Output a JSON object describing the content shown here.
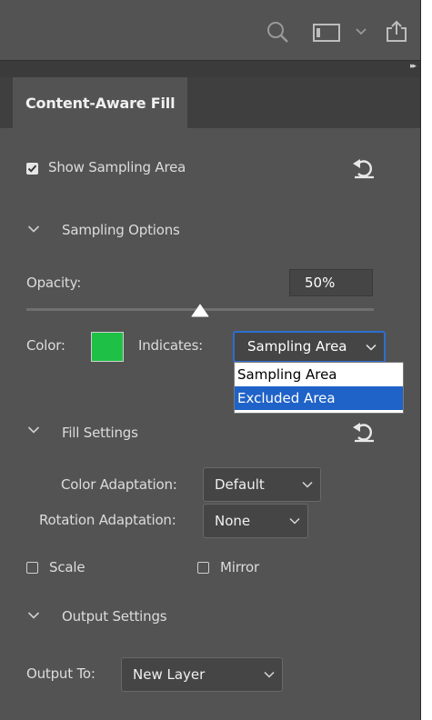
{
  "toolbar": {
    "icons": [
      "search-icon",
      "panel-layout-icon",
      "chevron-down-icon",
      "share-icon"
    ],
    "collapse_glyph": "▸▸"
  },
  "tab": {
    "label": "Content-Aware Fill"
  },
  "show_sampling": {
    "label": "Show Sampling Area",
    "checked": true
  },
  "sampling_options": {
    "title": "Sampling Options",
    "opacity_label": "Opacity:",
    "opacity_value": "50%",
    "opacity_level": 0.5,
    "color_label": "Color:",
    "color": "#1ec145",
    "indicates_label": "Indicates:",
    "indicates_value": "Sampling Area",
    "indicates_options": [
      "Sampling Area",
      "Excluded Area"
    ],
    "highlighted_option": "Excluded Area"
  },
  "fill_settings": {
    "title": "Fill Settings",
    "color_adaptation_label": "Color Adaptation:",
    "color_adaptation_value": "Default",
    "rotation_adaptation_label": "Rotation Adaptation:",
    "rotation_adaptation_value": "None",
    "scale_label": "Scale",
    "mirror_label": "Mirror"
  },
  "output_settings": {
    "title": "Output Settings",
    "output_to_label": "Output To:",
    "output_to_value": "New Layer"
  },
  "colors": {
    "panel_bg": "#535353",
    "tab_row_bg": "#3f3f3f",
    "accent_blue": "#1f62c8"
  }
}
